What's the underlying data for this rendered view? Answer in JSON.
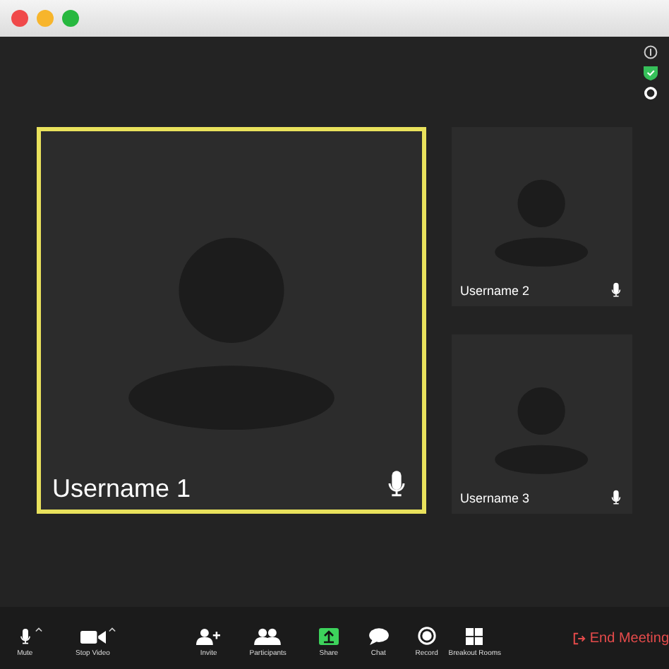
{
  "window": {
    "controls": [
      {
        "kind": "close"
      },
      {
        "kind": "minimize"
      },
      {
        "kind": "zoom"
      }
    ]
  },
  "participants": [
    {
      "username": "Username 1",
      "active_speaker": true
    },
    {
      "username": "Username 2",
      "active_speaker": false
    },
    {
      "username": "Username 3",
      "active_speaker": false
    }
  ],
  "toolbar": [
    {
      "label": "Mute",
      "kind": "mic",
      "has_menu": true
    },
    {
      "label": "Stop Video",
      "kind": "camera",
      "has_menu": true
    },
    {
      "label": "Invite",
      "kind": "invite",
      "has_menu": false
    },
    {
      "label": "Participants",
      "kind": "participants",
      "has_menu": false
    },
    {
      "label": "Share",
      "kind": "share",
      "has_menu": false
    },
    {
      "label": "Chat",
      "kind": "chat",
      "has_menu": false
    },
    {
      "label": "Record",
      "kind": "record",
      "has_menu": false
    },
    {
      "label": "Breakout Rooms",
      "kind": "grid",
      "has_menu": false
    }
  ],
  "end_button": {
    "label": "End Meeting"
  }
}
